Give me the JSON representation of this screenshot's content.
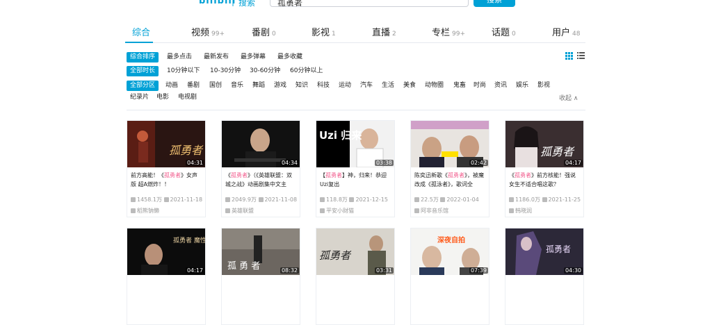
{
  "header": {
    "logo": "bilibili",
    "logo_sep": "|",
    "logo_sub": "搜索",
    "search_value": "孤勇者",
    "search_button": "搜索"
  },
  "tabs": [
    {
      "label": "综合",
      "count": ""
    },
    {
      "label": "视频",
      "count": "99+"
    },
    {
      "label": "番剧",
      "count": "0"
    },
    {
      "label": "影视",
      "count": "1"
    },
    {
      "label": "直播",
      "count": "2"
    },
    {
      "label": "专栏",
      "count": "99+"
    },
    {
      "label": "话题",
      "count": "0"
    },
    {
      "label": "用户",
      "count": "48"
    }
  ],
  "sort_options": [
    "综合排序",
    "最多点击",
    "最新发布",
    "最多弹幕",
    "最多收藏"
  ],
  "duration_options": [
    "全部时长",
    "10分钟以下",
    "10-30分钟",
    "30-60分钟",
    "60分钟以上"
  ],
  "category_options": [
    "全部分区",
    "动画",
    "番剧",
    "国创",
    "音乐",
    "舞蹈",
    "游戏",
    "知识",
    "科技",
    "运动",
    "汽车",
    "生活",
    "美食",
    "动物圈",
    "鬼畜",
    "时尚",
    "资讯",
    "娱乐",
    "影视"
  ],
  "category_options_row2": [
    "纪录片",
    "电影",
    "电视剧"
  ],
  "collapse_label": "收起 ∧",
  "colors": {
    "accent": "#00a1d6",
    "highlight": "#f25d8e"
  },
  "videos": [
    {
      "duration": "04:31",
      "title_pre": "前方高能！《",
      "title_hl": "孤勇者",
      "title_post": "》女声版 超A燃炸！！",
      "views": "1458.1万",
      "date": "2021-11-18",
      "author": "稻熊钠懒"
    },
    {
      "duration": "04:34",
      "title_pre": "《",
      "title_hl": "孤勇者",
      "title_post": "》（《英雄联盟：双城之战》动画剧集中文主",
      "views": "2049.9万",
      "date": "2021-11-08",
      "author": "英雄联盟"
    },
    {
      "duration": "03:38",
      "title_pre": "【",
      "title_hl": "孤勇者",
      "title_post": "】神，归来！恭迎Uzi复出",
      "views": "118.8万",
      "date": "2021-12-15",
      "author": "平安小财猫"
    },
    {
      "duration": "02:42",
      "title_pre": "陈奕迅新歌《",
      "title_hl": "孤勇者",
      "title_post": "》，被魔改成《孤泳者》，歌词全",
      "views": "22.5万",
      "date": "2022-01-04",
      "author": "阿非音乐馆"
    },
    {
      "duration": "04:17",
      "title_pre": "《",
      "title_hl": "孤勇者",
      "title_post": "》前方核能！强说女生不适合唱这歌？",
      "views": "1186.0万",
      "date": "2021-11-25",
      "author": "韩晓润"
    },
    {
      "duration": "04:17",
      "title_pre": "",
      "title_hl": "",
      "title_post": "",
      "views": "",
      "date": "",
      "author": ""
    },
    {
      "duration": "08:32",
      "title_pre": "",
      "title_hl": "",
      "title_post": "",
      "views": "",
      "date": "",
      "author": ""
    },
    {
      "duration": "03:31",
      "title_pre": "",
      "title_hl": "",
      "title_post": "",
      "views": "",
      "date": "",
      "author": ""
    },
    {
      "duration": "07:39",
      "title_pre": "",
      "title_hl": "",
      "title_post": "",
      "views": "",
      "date": "",
      "author": ""
    },
    {
      "duration": "04:30",
      "title_pre": "",
      "title_hl": "",
      "title_post": "",
      "views": "",
      "date": "",
      "author": ""
    }
  ],
  "thumb_text": [
    "孤勇者",
    "",
    "Uzi 归来",
    "",
    "孤勇者",
    "孤勇者 魔性版",
    "孤 勇 者",
    "孤勇者",
    "深夜自拍",
    "孤勇者"
  ]
}
